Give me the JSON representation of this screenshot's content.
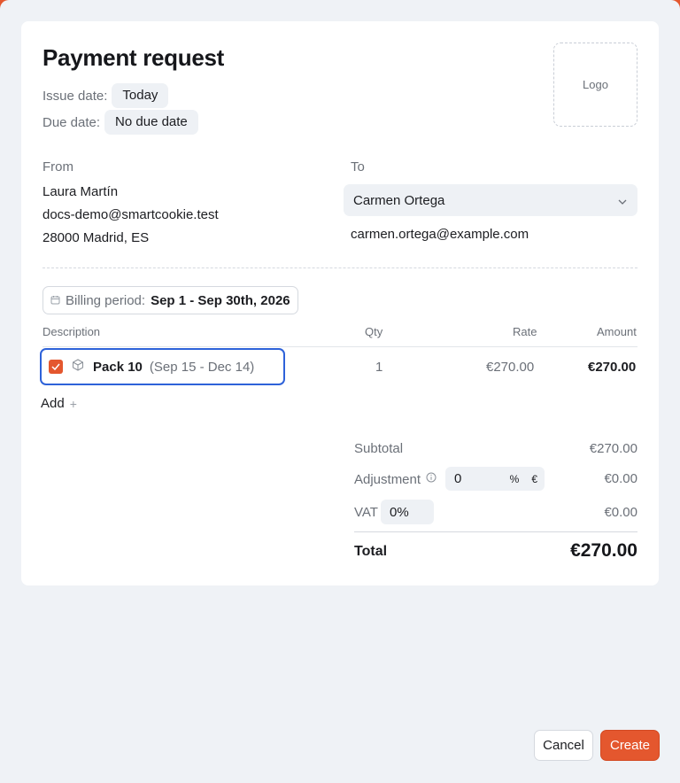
{
  "header": {
    "title": "Payment request",
    "issue_label": "Issue date:",
    "issue_value": "Today",
    "due_label": "Due date:",
    "due_value": "No due date",
    "logo_label": "Logo"
  },
  "from": {
    "label": "From",
    "name": "Laura Martín",
    "email": "docs-demo@smartcookie.test",
    "address": "28000 Madrid, ES"
  },
  "to": {
    "label": "To",
    "selected": "Carmen Ortega",
    "email": "carmen.ortega@example.com"
  },
  "billing": {
    "label": "Billing period:",
    "value": "Sep 1 - Sep 30th, 2026"
  },
  "table": {
    "headers": {
      "description": "Description",
      "qty": "Qty",
      "rate": "Rate",
      "amount": "Amount"
    },
    "rows": [
      {
        "name": "Pack 10",
        "range": "(Sep 15 - Dec 14)",
        "qty": "1",
        "rate": "€270.00",
        "amount": "€270.00",
        "checked": true
      }
    ],
    "add_label": "Add"
  },
  "totals": {
    "subtotal_label": "Subtotal",
    "subtotal_value": "€270.00",
    "adjustment_label": "Adjustment",
    "adjustment_input": "0",
    "adjustment_unit_percent": "%",
    "adjustment_unit_currency": "€",
    "adjustment_value": "€0.00",
    "vat_label": "VAT",
    "vat_input": "0%",
    "vat_value": "€0.00",
    "total_label": "Total",
    "total_value": "€270.00"
  },
  "footer": {
    "cancel_label": "Cancel",
    "create_label": "Create"
  },
  "colors": {
    "accent": "#e4572e",
    "focus": "#2e62d9",
    "background": "#eff2f6"
  }
}
